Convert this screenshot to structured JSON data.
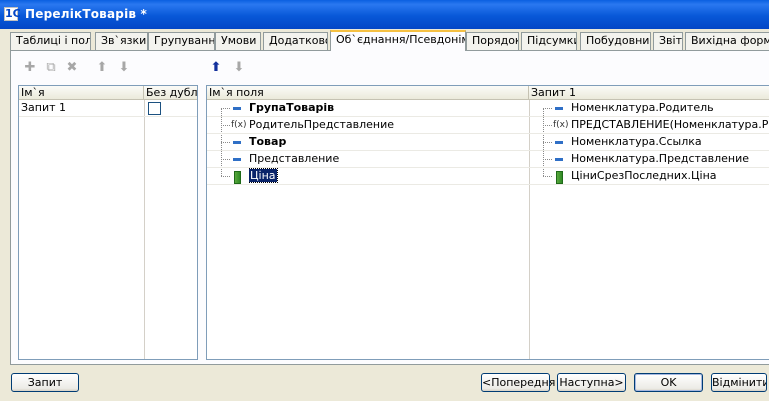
{
  "window": {
    "title": "ПерелікТоварів *",
    "app_icon": "1С"
  },
  "tabs": [
    "Таблиці і поля",
    "Зв`язки",
    "Групування",
    "Умови",
    "Додатково",
    "Об`єднання/Псевдоніми",
    "Порядок",
    "Підсумки",
    "Побудовник",
    "Звіт",
    "Вихідна форма"
  ],
  "active_tab": "Об`єднання/Псевдоніми",
  "left_toolbar": [
    "add-query-icon",
    "copy-query-icon",
    "delete-query-icon",
    "move-up-icon",
    "move-down-icon"
  ],
  "right_toolbar": [
    "move-up-icon",
    "move-down-icon"
  ],
  "queries_table": {
    "headers": {
      "name": "Ім`я",
      "no_duplicates": "Без дубл."
    },
    "rows": [
      {
        "name": "Запит 1",
        "no_duplicates": false
      }
    ]
  },
  "aliases_table": {
    "headers": {
      "field_name": "Ім`я поля",
      "query": "Запит 1"
    },
    "rows": [
      {
        "field": "ГрупаТоварів",
        "source": "Номенклатура.Родитель",
        "field_icon": "field-icon",
        "source_icon": "field-icon",
        "bold": true
      },
      {
        "field": "РодительПредставление",
        "source": "ПРЕДСТАВЛЕНИЕ(Номенклатура.Родитель)",
        "field_icon": "function-icon",
        "source_icon": "function-icon",
        "func_glyph": "f(x)",
        "bold": false
      },
      {
        "field": "Товар",
        "source": "Номенклатура.Ссылка",
        "field_icon": "field-icon",
        "source_icon": "field-icon",
        "bold": true
      },
      {
        "field": "Представление",
        "source": "Номенклатура.Представление",
        "field_icon": "field-icon",
        "source_icon": "field-icon",
        "bold": false
      },
      {
        "field": "Ціна",
        "source": "ЦіниСрезПоследних.Ціна",
        "field_icon": "price-icon",
        "source_icon": "price-icon",
        "bold": false,
        "selected": true
      }
    ]
  },
  "buttons": {
    "query": "Запит",
    "previous": "<Попередня",
    "next": "Наступна>",
    "ok": "OK",
    "cancel": "Відмінити"
  },
  "colors": {
    "titlebar": "#0346c6",
    "selection": "#0a246a",
    "active_tab_accent": "#f5c042",
    "window_bg": "#ece9d8"
  }
}
